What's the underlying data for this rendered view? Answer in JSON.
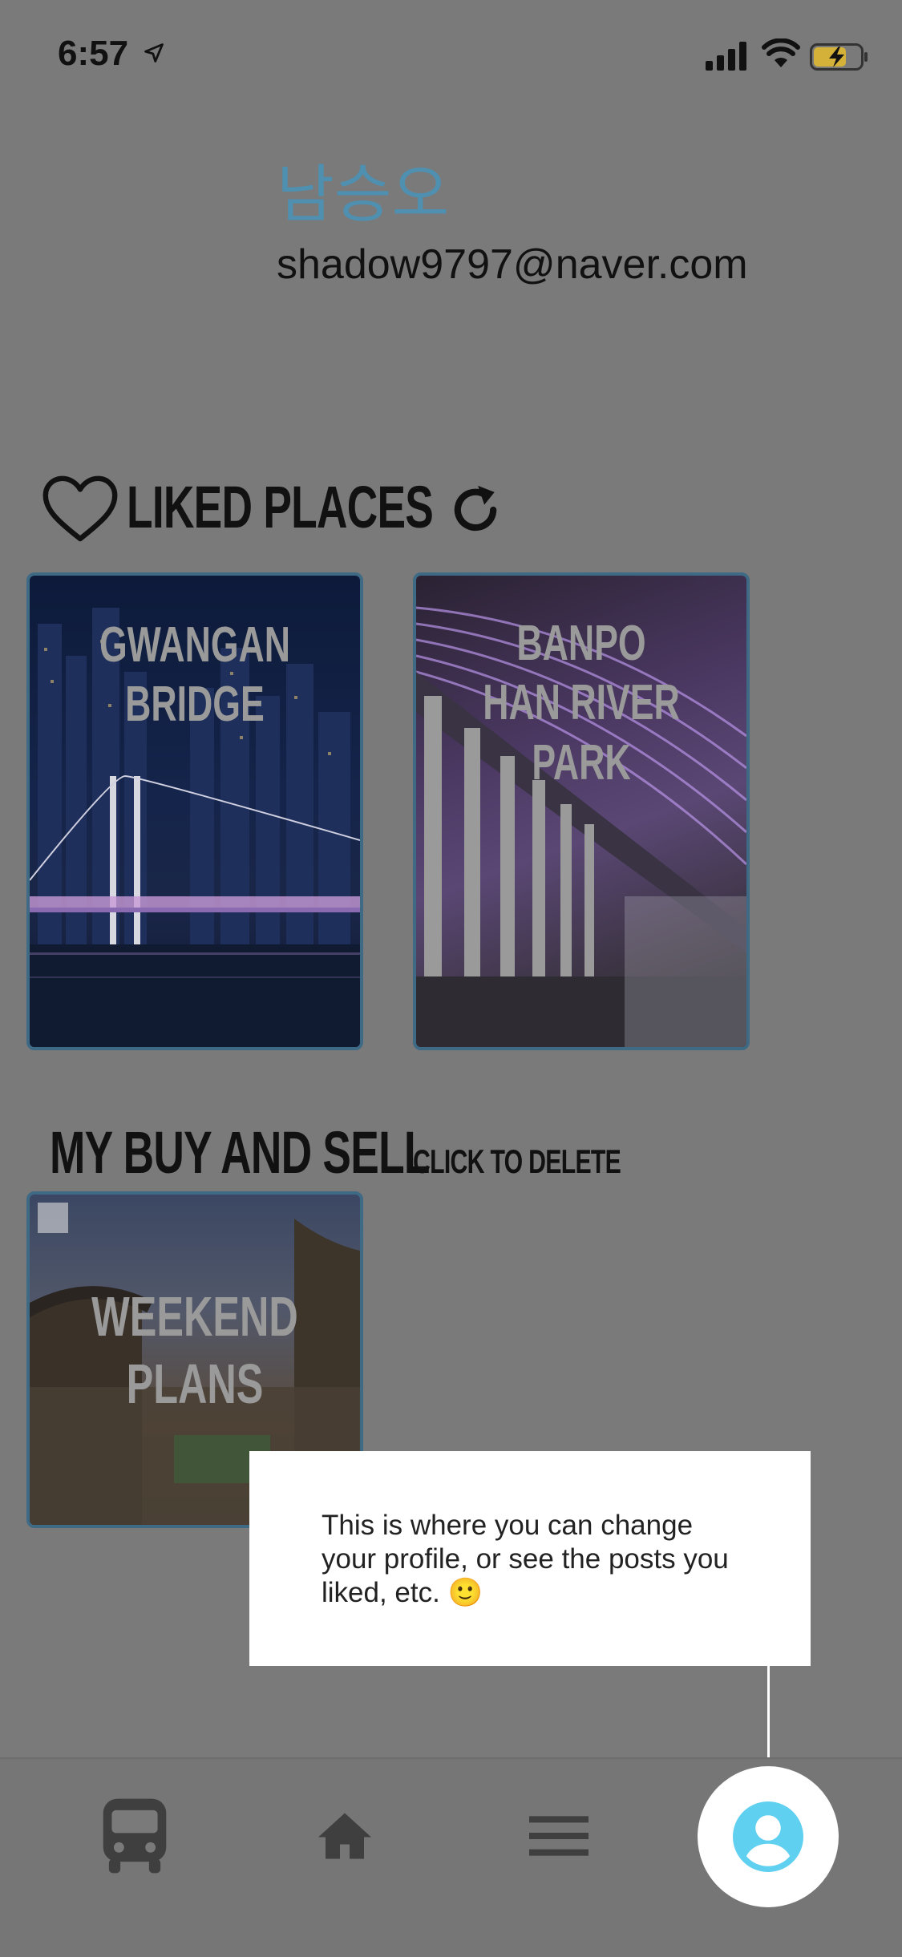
{
  "status_bar": {
    "time": "6:57"
  },
  "profile": {
    "name": "남승오",
    "email": "shadow9797@naver.com"
  },
  "liked": {
    "title": "LIKED PLACES",
    "cards": [
      {
        "title_lines": [
          "GWANGAN BRIDGE"
        ]
      },
      {
        "title_lines": [
          "BANPO",
          "HAN RIVER PARK"
        ]
      }
    ]
  },
  "buy_sell": {
    "title": "MY BUY AND SELL",
    "hint": "CLICK TO DELETE",
    "cards": [
      {
        "title_lines": [
          "WEEKEND",
          "PLANS"
        ]
      }
    ]
  },
  "tooltip": {
    "text": "This is  where you can change your profile, or see the posts you liked, etc. 🙂"
  },
  "icons": {
    "heart": "heart-outline-icon",
    "refresh": "refresh-icon",
    "bus": "bus-icon",
    "home": "home-icon",
    "menu": "menu-icon",
    "profile": "account-circle-icon"
  },
  "colors": {
    "accent": "#5fd0f0",
    "name": "#4f8fb0",
    "card_border": "#3e6a85"
  }
}
